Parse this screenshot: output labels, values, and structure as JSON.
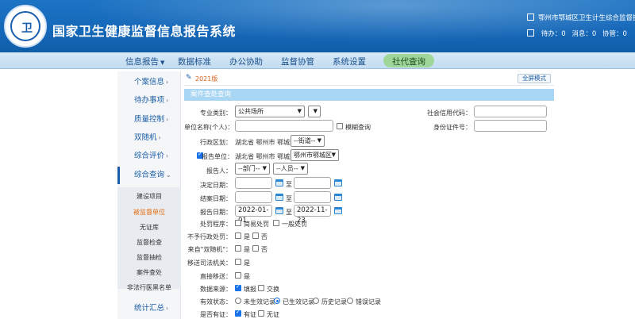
{
  "header": {
    "logo_text": "卫",
    "title": "国家卫生健康监督信息报告系统",
    "org": "鄂州市鄂城区卫生计生综合监督执法局",
    "todo_label": "待办：",
    "todo_count": "0",
    "msg_label": "消息：",
    "msg_count": "0",
    "collab_label": "协管：",
    "collab_count": "0"
  },
  "nav": {
    "items": [
      "信息报告",
      "数据标准",
      "办公协助",
      "监督协管",
      "系统设置",
      "社代查询"
    ],
    "active_index": 5
  },
  "sidebar": {
    "items": [
      "个案信息",
      "待办事项",
      "质量控制",
      "双随机",
      "综合评价",
      "综合查询",
      "统计汇总"
    ],
    "subitems": [
      "建设项目",
      "被监督单位",
      "无证库",
      "监督检查",
      "监督抽检",
      "案件查处",
      "非法行医黑名单"
    ],
    "selected_sub": "被监督单位"
  },
  "content": {
    "year": "2021版",
    "fullscreen": "全屏模式",
    "section_title": "案件查处查询",
    "prof_category_label": "专业类别：",
    "prof_category_value": "公共场所",
    "credit_code_label": "社会信用代码：",
    "unit_name_label": "单位名称(个人)：",
    "fuzzy_label": "模糊查询",
    "id_label": "身份证件号：",
    "region_label": "行政区划：",
    "region_value": "湖北省  鄂州市  鄂城区",
    "street_value": "--街道--",
    "reporter_unit_label": "报告单位：",
    "reporter_unit_region": "湖北省  鄂州市  鄂城区",
    "reporter_unit_value": "鄂州市鄂城区",
    "reporter_label": "报告人：",
    "dept_value": "--部门--",
    "person_value": "--人员--",
    "decision_date_label": "决定日期：",
    "close_date_label": "结案日期：",
    "report_date_label": "报告日期：",
    "report_date_from": "2022-01-01",
    "report_date_to": "2022-11-23",
    "to_label": "至",
    "procedure_label": "处罚程序：",
    "procedure_options": [
      "简易处罚",
      "一般处罚"
    ],
    "no_penalty_label": "不予行政处罚：",
    "from_random_label": "来自\"双随机\"：",
    "transfer_label": "移送司法机关：",
    "urgent_label": "直接移送：",
    "yes_label": "是",
    "no_label": "否",
    "data_source_label": "数据来源：",
    "data_source_options": [
      "填报",
      "交换"
    ],
    "valid_status_label": "有效状态：",
    "valid_status_options": [
      "未生效记录",
      "已生效记录",
      "历史记录",
      "错误记录"
    ],
    "has_license_label": "是否有证：",
    "has_license_options": [
      "有证",
      "无证"
    ]
  },
  "colors": {
    "header_blue": "#1567b8",
    "nav_active_green": "#9fd79a",
    "section_blue": "#a9d6f3",
    "selected_orange": "#e66a0c"
  }
}
